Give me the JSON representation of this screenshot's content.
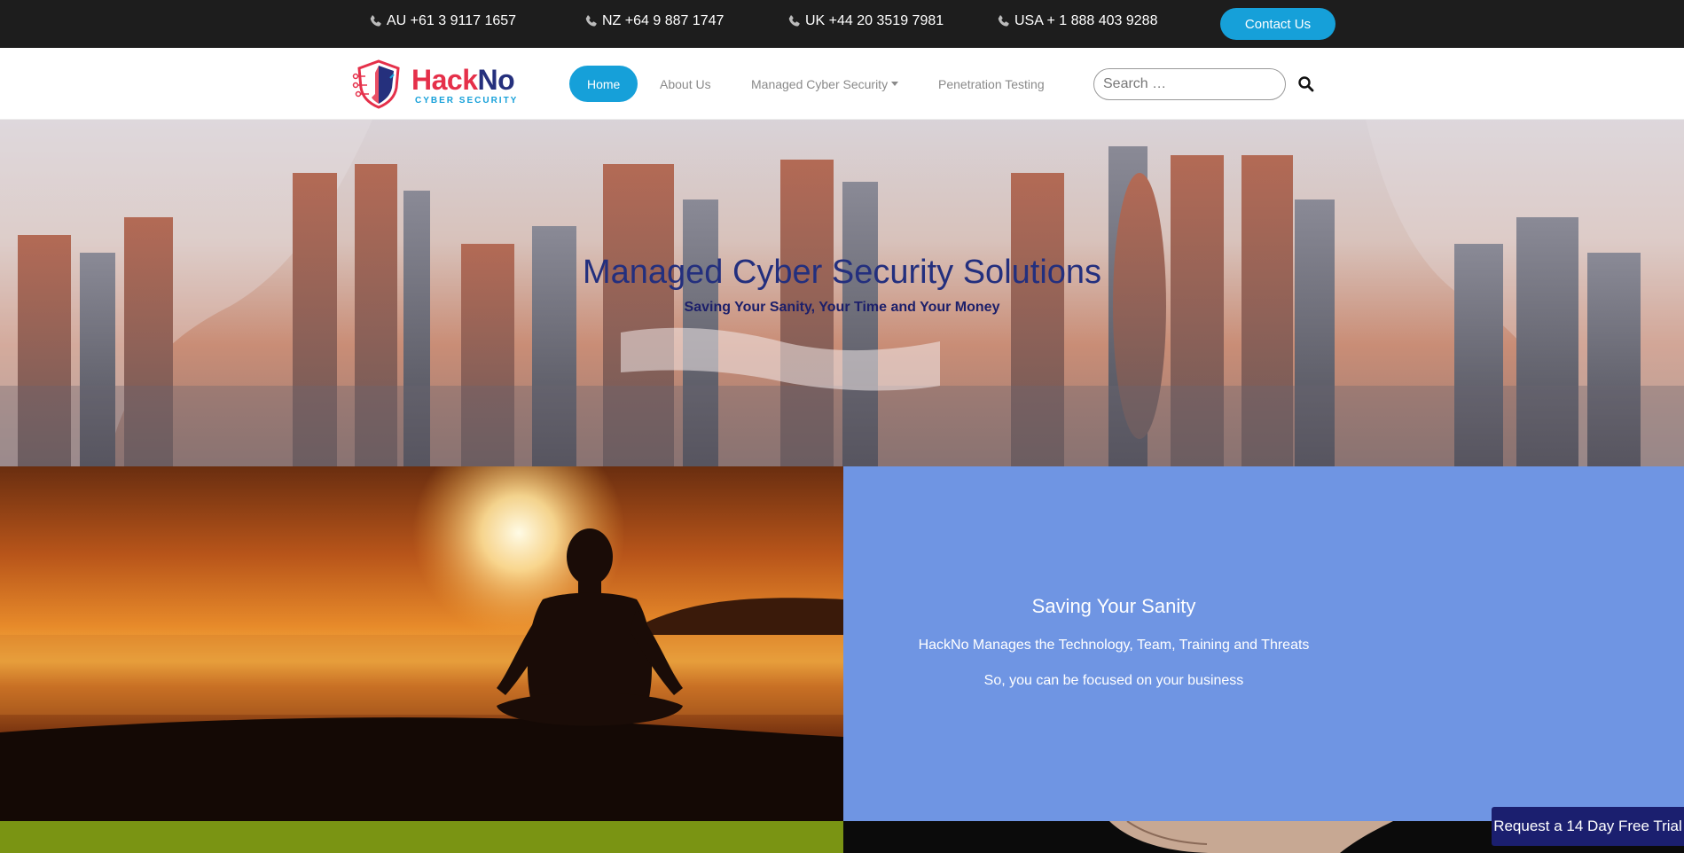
{
  "topbar": {
    "phones": [
      {
        "label": "AU +61 3 9117 1657",
        "icon": "phone-icon"
      },
      {
        "label": "NZ +64 9 887 1747",
        "icon": "phone-icon"
      },
      {
        "label": "UK +44 20 3519 7981",
        "icon": "phone-icon"
      },
      {
        "label": "USA + 1 888 403 9288",
        "icon": "phone-icon"
      }
    ],
    "contact_label": "Contact Us"
  },
  "logo": {
    "word_a": "Hack",
    "word_b": "No",
    "sub": "CYBER SECURITY",
    "icon": "shield-circuit-icon"
  },
  "nav": {
    "items": [
      {
        "label": "Home",
        "active": true
      },
      {
        "label": "About Us",
        "active": false
      },
      {
        "label": "Managed Cyber Security",
        "active": false,
        "dropdown": true
      },
      {
        "label": "Penetration Testing",
        "active": false
      }
    ],
    "search_placeholder": "Search …",
    "search_icon": "search-icon"
  },
  "hero": {
    "title": "Managed Cyber Security Solutions",
    "subtitle": "Saving Your Sanity, Your Time and Your Money"
  },
  "sanity": {
    "title": "Saving Your Sanity",
    "line1": "HackNo Manages the Technology, Team, Training and Threats",
    "line2": "So, you can be focused on your business"
  },
  "cta": {
    "trial_label": "Request a 14 Day Free Trial"
  },
  "colors": {
    "accent": "#16a0d9",
    "brand_red": "#e5304a",
    "brand_navy": "#25307d",
    "panel_blue": "#6f95e3",
    "panel_green": "#7a9413",
    "topbar": "#1d1d1d"
  }
}
